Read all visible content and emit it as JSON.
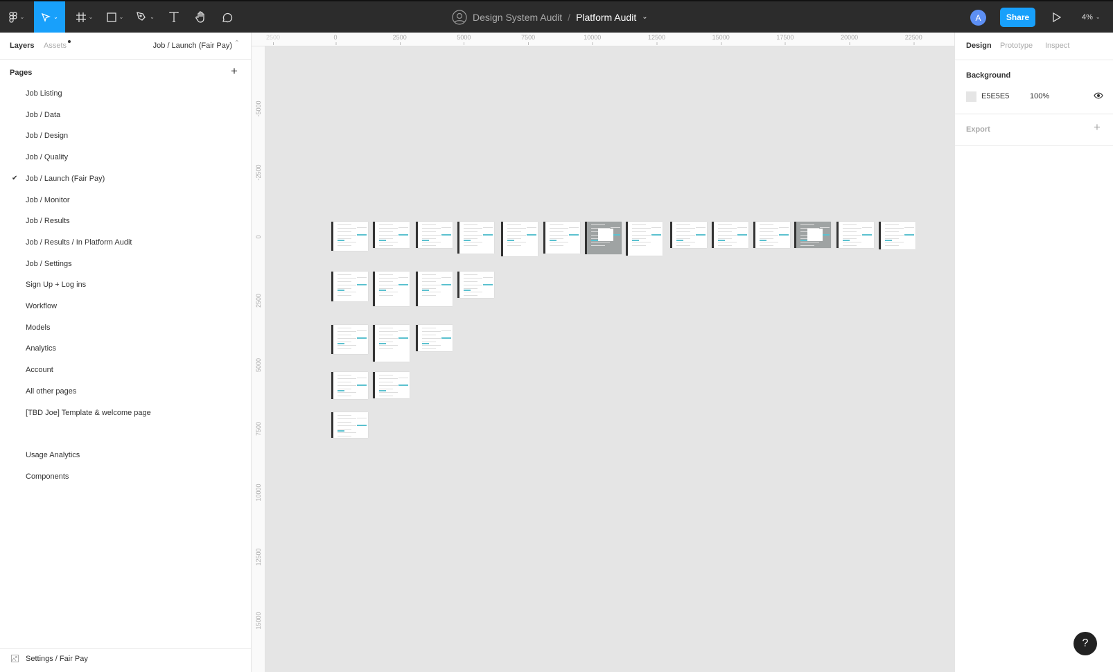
{
  "toolbar": {
    "tools": [
      "main-menu",
      "move",
      "frame",
      "rectangle",
      "pen",
      "text",
      "hand",
      "comment"
    ],
    "active_tool": "move",
    "accent": "#18a0fb",
    "project": "Design System Audit",
    "separator": "/",
    "file": "Platform Audit",
    "avatar_initial": "A",
    "share_label": "Share",
    "zoom_level": "4%"
  },
  "left_panel": {
    "tabs": [
      "Layers",
      "Assets"
    ],
    "current_page": "Job / Launch (Fair Pay)",
    "pages_label": "Pages",
    "pages": [
      "Job Listing",
      "Job / Data",
      "Job / Design",
      "Job / Quality",
      "Job / Launch (Fair Pay)",
      "Job / Monitor",
      "Job / Results",
      "Job / Results / In Platform Audit",
      "Job / Settings",
      "Sign Up + Log ins",
      "Workflow",
      "Models",
      "Analytics",
      "Account",
      "All other pages",
      "[TBD Joe] Template & welcome page",
      "",
      "Usage Analytics",
      "Components"
    ],
    "selected_page_index": 4,
    "layer": "Settings / Fair Pay"
  },
  "rulers": {
    "x_labels": [
      "2500",
      "0",
      "2500",
      "5000",
      "7500",
      "10000",
      "12500",
      "15000",
      "17500",
      "20000",
      "22500"
    ],
    "y_labels": [
      "-5000",
      "-2500",
      "0",
      "2500",
      "5000",
      "7500",
      "10000",
      "12500",
      "15000"
    ]
  },
  "right_panel": {
    "tabs": [
      "Design",
      "Prototype",
      "Inspect"
    ],
    "background_label": "Background",
    "bg_color": "E5E5E5",
    "bg_opacity": "100%",
    "export_label": "Export"
  },
  "help_label": "?"
}
